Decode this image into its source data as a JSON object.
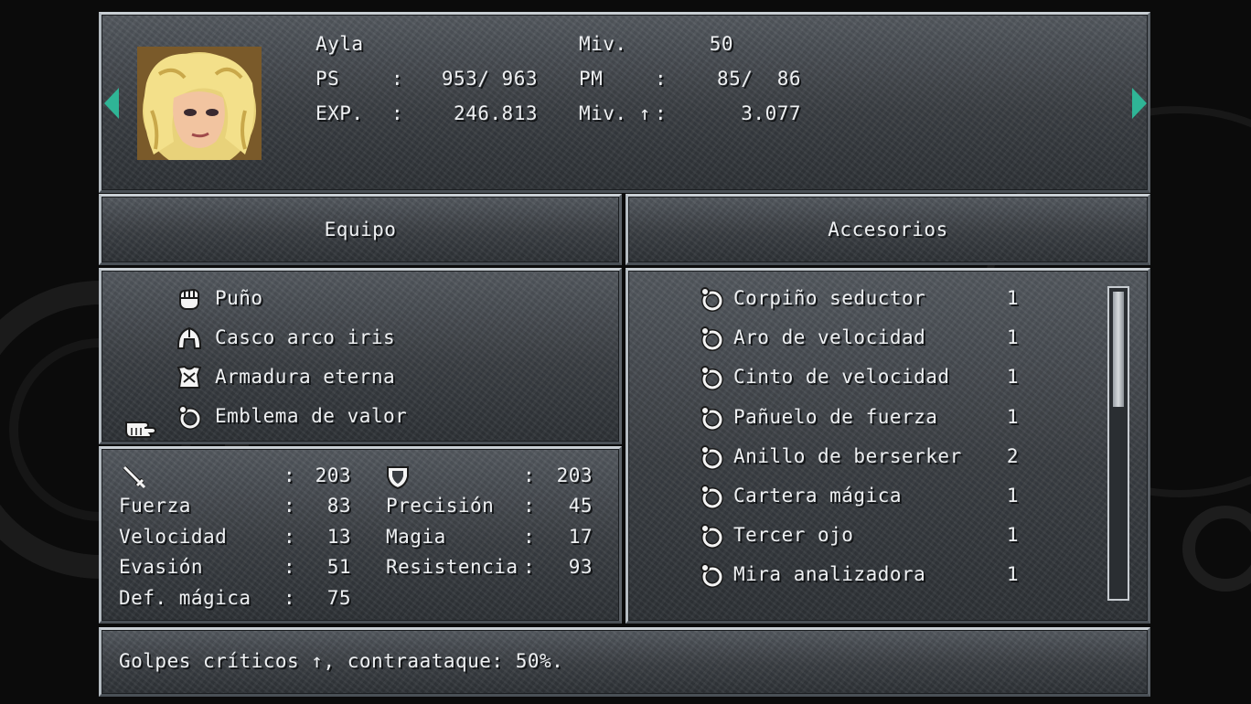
{
  "character": {
    "name": "Ayla",
    "level_label": "Miv.",
    "level": "50",
    "hp_label": "PS",
    "hp_sep": ":",
    "hp_value": "953/ 963",
    "mp_label": "PM",
    "mp_sep": ":",
    "mp_value": "85/  86",
    "exp_label": "EXP.",
    "exp_sep": ":",
    "exp_value": "246.813",
    "next_label": "Miv. ↑",
    "next_sep": ":",
    "next_value": "3.077"
  },
  "headers": {
    "equipment": "Equipo",
    "accessories": "Accesorios"
  },
  "equipment": [
    {
      "icon": "fist-icon",
      "label": "Puño"
    },
    {
      "icon": "helmet-icon",
      "label": "Casco arco iris"
    },
    {
      "icon": "armor-icon",
      "label": "Armadura eterna"
    },
    {
      "icon": "ring-icon",
      "label": "Emblema de valor"
    }
  ],
  "stats": {
    "attack_sep": ":",
    "attack": "203",
    "defense_sep": ":",
    "defense": "203",
    "left": [
      {
        "label": "Fuerza",
        "sep": ":",
        "value": "83"
      },
      {
        "label": "Velocidad",
        "sep": ":",
        "value": "13"
      },
      {
        "label": "Evasión",
        "sep": ":",
        "value": "51"
      },
      {
        "label": "Def. mágica",
        "sep": ":",
        "value": "75"
      }
    ],
    "right": [
      {
        "label": "Precisión",
        "sep": ":",
        "value": "45"
      },
      {
        "label": "Magia",
        "sep": ":",
        "value": "17"
      },
      {
        "label": "Resistencia",
        "sep": ":",
        "value": "93"
      }
    ]
  },
  "accessories": [
    {
      "label": "Corpiño seductor",
      "qty": "1"
    },
    {
      "label": "Aro de velocidad",
      "qty": "1"
    },
    {
      "label": "Cinto de velocidad",
      "qty": "1"
    },
    {
      "label": "Pañuelo de fuerza",
      "qty": "1"
    },
    {
      "label": "Anillo de berserker",
      "qty": "2"
    },
    {
      "label": "Cartera mágica",
      "qty": "1"
    },
    {
      "label": "Tercer ojo",
      "qty": "1"
    },
    {
      "label": "Mira analizadora",
      "qty": "1"
    }
  ],
  "description": "Golpes críticos ↑, contraataque: 50%.",
  "colors": {
    "arrow": "#2fb596",
    "text": "#eef0f2",
    "panel": "#44494e"
  }
}
